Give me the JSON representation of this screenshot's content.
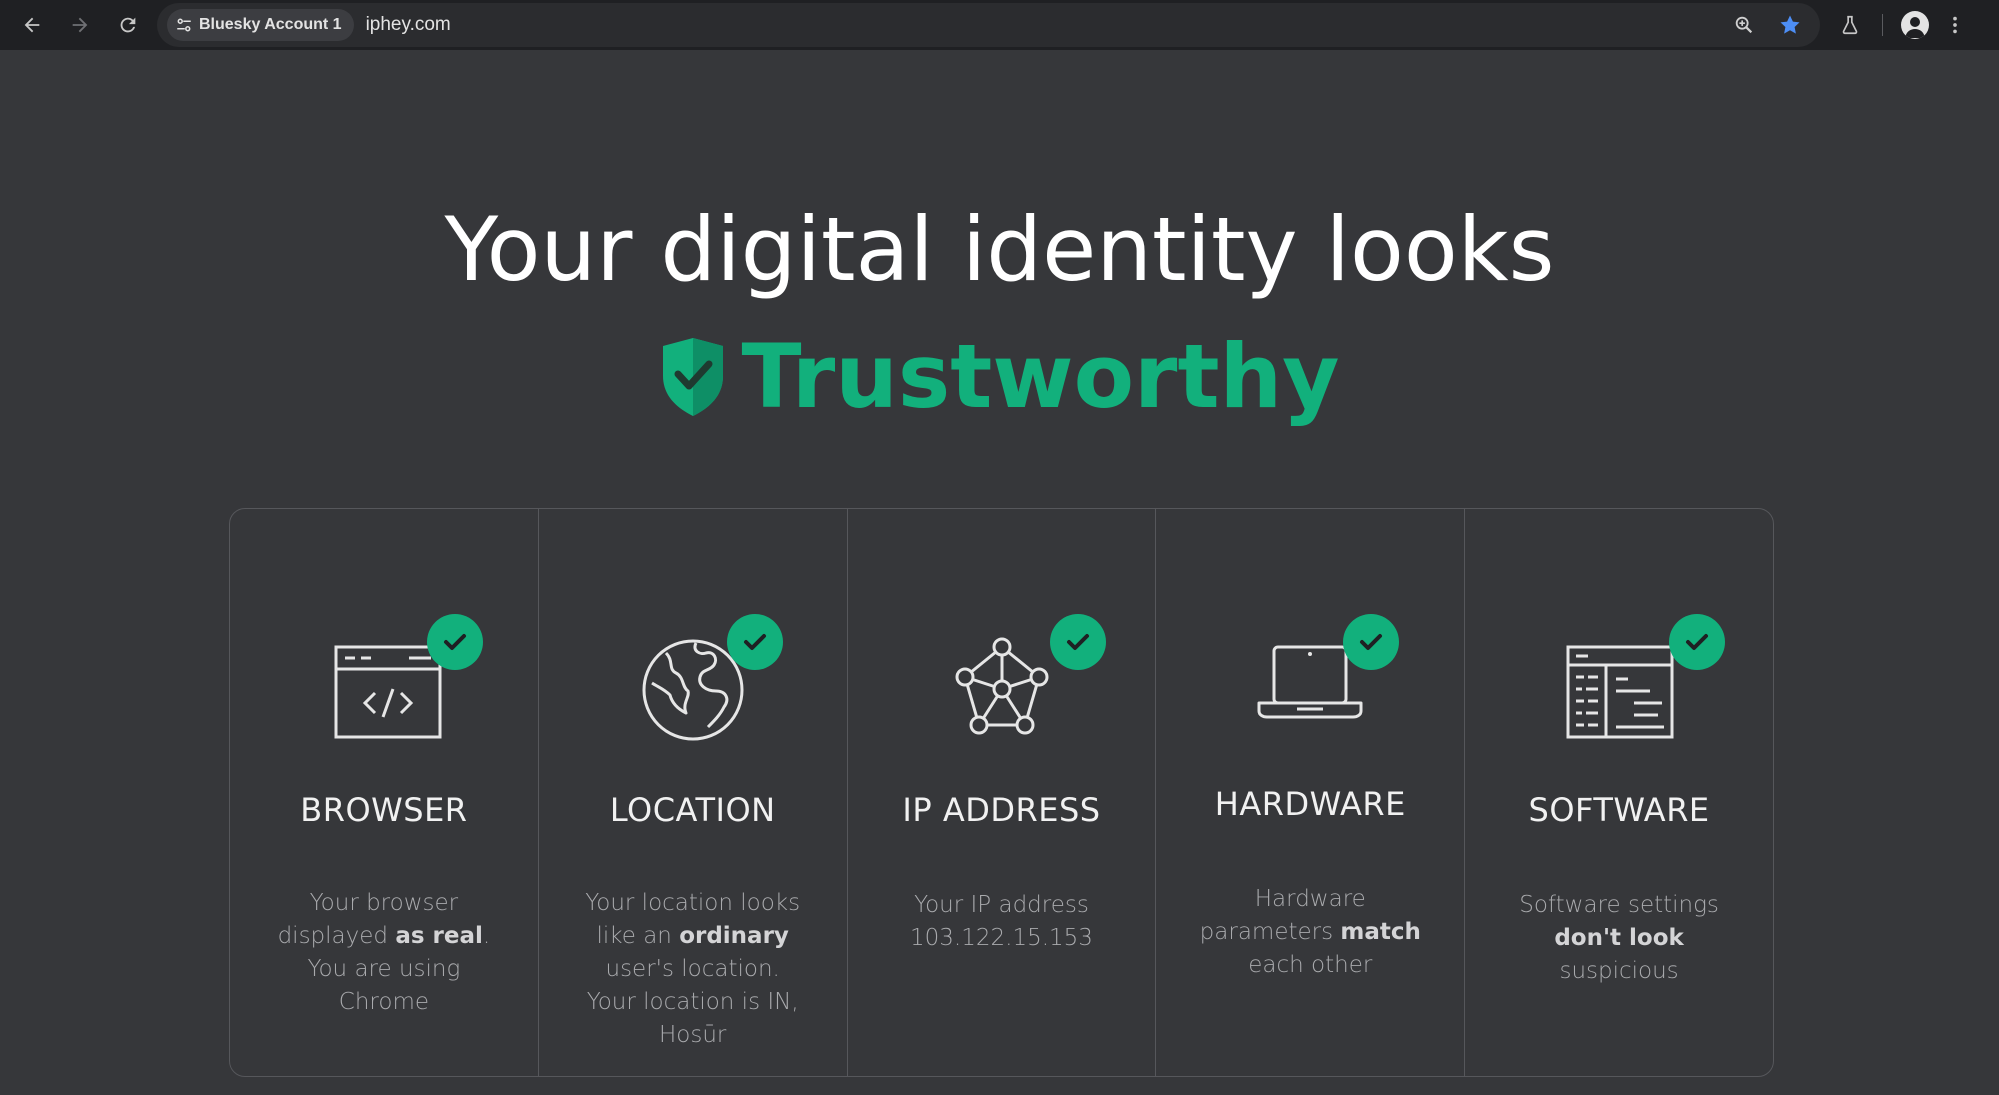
{
  "browser_chrome": {
    "profile_chip_label": "Bluesky Account 1",
    "url": "iphey.com",
    "bookmark_star_color": "#4d8ef5"
  },
  "hero": {
    "title": "Your digital identity looks",
    "status": "Trustworthy",
    "status_color": "#12b07c"
  },
  "cards": [
    {
      "title": "BROWSER",
      "icon": "browser-code-icon",
      "desc_before": "Your browser displayed ",
      "desc_bold": "as real",
      "desc_after": ". You are using Chrome"
    },
    {
      "title": "LOCATION",
      "icon": "globe-icon",
      "desc_before": "Your location looks like an ",
      "desc_bold": "ordinary",
      "desc_after": " user's location. Your location is IN, Hosūr"
    },
    {
      "title": "IP ADDRESS",
      "icon": "network-nodes-icon",
      "desc_before": "Your IP address 103.122.15.153",
      "desc_bold": "",
      "desc_after": ""
    },
    {
      "title": "HARDWARE",
      "icon": "laptop-icon",
      "desc_before": "Hardware parameters ",
      "desc_bold": "match",
      "desc_after": " each other"
    },
    {
      "title": "SOFTWARE",
      "icon": "software-window-icon",
      "desc_before": "Software settings ",
      "desc_bold": "don't look",
      "desc_after": " suspicious"
    }
  ]
}
